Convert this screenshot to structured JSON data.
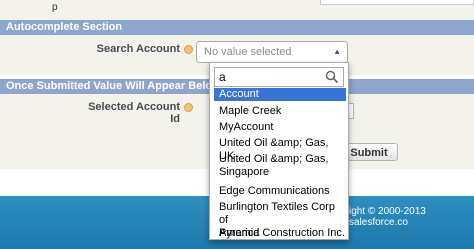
{
  "top_fragment": {
    "text": "p"
  },
  "autocomplete_section": {
    "title": "Autocomplete Section",
    "search_label": "Search Account",
    "select_value": "No value selected"
  },
  "dropdown": {
    "query": "a",
    "options": [
      "Account",
      "Maple Creek",
      "MyAccount",
      "United Oil &amp; Gas, UK",
      "United Oil &amp; Gas,",
      "Singapore",
      "Edge Communications",
      "Burlington Textiles Corp of",
      "America",
      "Pyramid Construction Inc."
    ]
  },
  "submitted_section": {
    "title": "Once Submitted Value Will Appear Below",
    "selected_label": "Selected Account Id",
    "submit_label": "Submit"
  },
  "footer": {
    "copyright": "ight © 2000-2013 salesforce.co"
  },
  "colors": {
    "section_header": "#8ea6cd",
    "selected_option": "#3875d7",
    "footer": "#1d79ad"
  }
}
